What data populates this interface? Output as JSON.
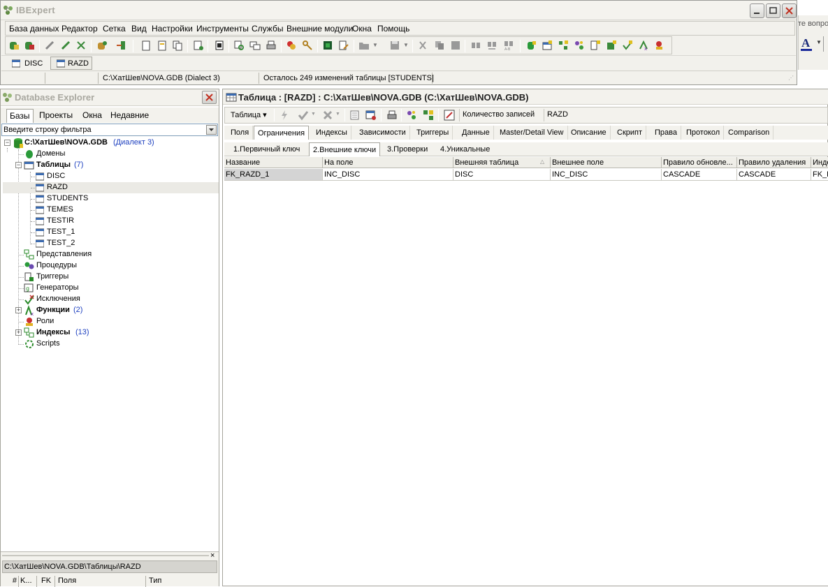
{
  "app": {
    "title": "IBExpert",
    "right_edge_text": "те вопрос"
  },
  "menu": [
    "База данных",
    "Редактор",
    "Сетка",
    "Вид",
    "Настройки",
    "Инструменты",
    "Службы",
    "Внешние модули",
    "Окна",
    "Помощь"
  ],
  "doc_tabs": [
    "DISC",
    "RAZD"
  ],
  "status": {
    "db": "C:\\ХатШев\\NOVA.GDB (Dialect 3)",
    "message": "Осталось 249 изменений таблицы [STUDENTS]"
  },
  "explorer": {
    "title": "Database Explorer",
    "tabs": [
      "Базы",
      "Проекты",
      "Окна",
      "Недавние"
    ],
    "filter_placeholder": "Введите строку фильтра",
    "db_name": "C:\\ХатШев\\NOVA.GDB",
    "db_dialect": "(Диалект 3)",
    "domains": "Домены",
    "tables_label": "Таблицы",
    "tables_count": "(7)",
    "tables": [
      "DISC",
      "RAZD",
      "STUDENTS",
      "TEMES",
      "TESTIR",
      "TEST_1",
      "TEST_2"
    ],
    "views": "Представления",
    "procedures": "Процедуры",
    "triggers": "Триггеры",
    "generators": "Генераторы",
    "exceptions": "Исключения",
    "functions_label": "Функции",
    "functions_count": "(2)",
    "roles": "Роли",
    "indexes_label": "Индексы",
    "indexes_count": "(13)",
    "scripts": "Scripts",
    "bottom_path": "C:\\ХатШев\\NOVA.GDB\\Таблицы\\RAZD",
    "bottom_cols": [
      "#",
      "K...",
      "FK",
      "Поля",
      "Тип"
    ]
  },
  "table_window": {
    "title": "Таблица : [RAZD] : C:\\ХатШев\\NOVA.GDB (C:\\ХатШев\\NOVA.GDB)",
    "table_menu": "Таблица ▾",
    "count_label": "Количество записей",
    "count_value": "RAZD",
    "tabs": [
      "Поля",
      "Ограничения",
      "Индексы",
      "Зависимости",
      "Триггеры",
      "Данные",
      "Master/Detail View",
      "Описание",
      "Скрипт",
      "Права",
      "Протокол",
      "Comparison"
    ],
    "subtabs": [
      "1.Первичный ключ",
      "2.Внешние ключи",
      "3.Проверки",
      "4.Уникальные"
    ],
    "grid_columns": [
      "Название",
      "На поле",
      "Внешняя таблица",
      "Внешнее поле",
      "Правило обновле...",
      "Правило удаления",
      "Индек"
    ],
    "grid_rows": [
      [
        "FK_RAZD_1",
        "INC_DISC",
        "DISC",
        "INC_DISC",
        "CASCADE",
        "CASCADE",
        "FK_R"
      ]
    ]
  }
}
